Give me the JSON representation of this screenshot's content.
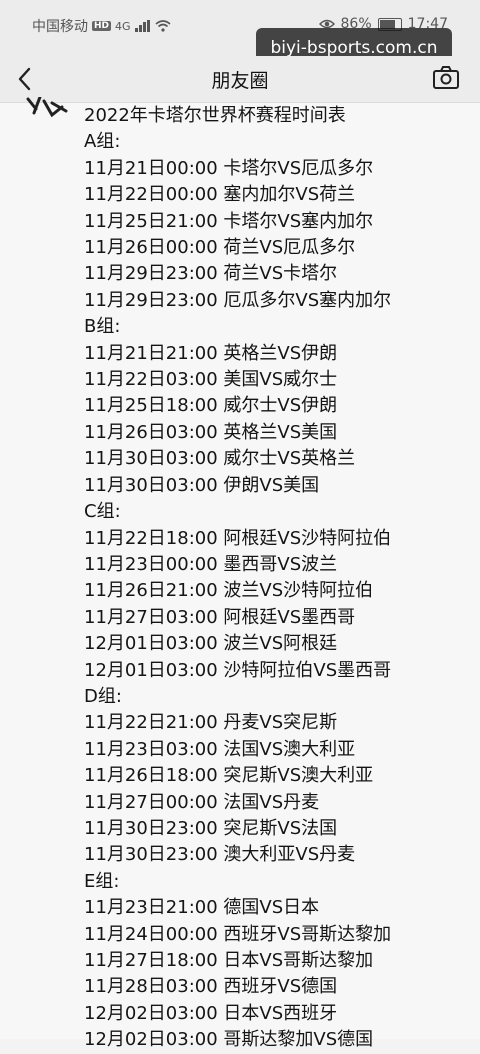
{
  "status": {
    "carrier": "中国移动",
    "hd": "HD",
    "signal": "4G",
    "battery_pct": "86%",
    "battery_level": 0.86,
    "time": "17:47"
  },
  "watermark": "biyi-bsports.com.cn",
  "nav": {
    "title": "朋友圈"
  },
  "post": {
    "title": "2022年卡塔尔世界杯赛程时间表",
    "groups": [
      {
        "name": "A组:",
        "matches": [
          "11月21日00:00 卡塔尔VS厄瓜多尔",
          "11月22日00:00 塞内加尔VS荷兰",
          "11月25日21:00 卡塔尔VS塞内加尔",
          "11月26日00:00 荷兰VS厄瓜多尔",
          "11月29日23:00 荷兰VS卡塔尔",
          "11月29日23:00 厄瓜多尔VS塞内加尔"
        ]
      },
      {
        "name": "B组:",
        "matches": [
          "11月21日21:00 英格兰VS伊朗",
          "11月22日03:00 美国VS威尔士",
          "11月25日18:00 威尔士VS伊朗",
          "11月26日03:00 英格兰VS美国",
          "11月30日03:00 威尔士VS英格兰",
          "11月30日03:00 伊朗VS美国"
        ]
      },
      {
        "name": "C组:",
        "matches": [
          "11月22日18:00 阿根廷VS沙特阿拉伯",
          "11月23日00:00 墨西哥VS波兰",
          "11月26日21:00 波兰VS沙特阿拉伯",
          "11月27日03:00 阿根廷VS墨西哥",
          "12月01日03:00 波兰VS阿根廷",
          "12月01日03:00 沙特阿拉伯VS墨西哥"
        ]
      },
      {
        "name": "D组:",
        "matches": [
          "11月22日21:00 丹麦VS突尼斯",
          "11月23日03:00 法国VS澳大利亚",
          "11月26日18:00 突尼斯VS澳大利亚",
          "11月27日00:00 法国VS丹麦",
          "11月30日23:00 突尼斯VS法国",
          "11月30日23:00 澳大利亚VS丹麦"
        ]
      },
      {
        "name": "E组:",
        "matches": [
          "11月23日21:00 德国VS日本",
          "11月24日00:00 西班牙VS哥斯达黎加",
          "11月27日18:00 日本VS哥斯达黎加",
          "11月28日03:00 西班牙VS德国",
          "12月02日03:00 日本VS西班牙",
          "12月02日03:00 哥斯达黎加VS德国"
        ]
      }
    ]
  }
}
